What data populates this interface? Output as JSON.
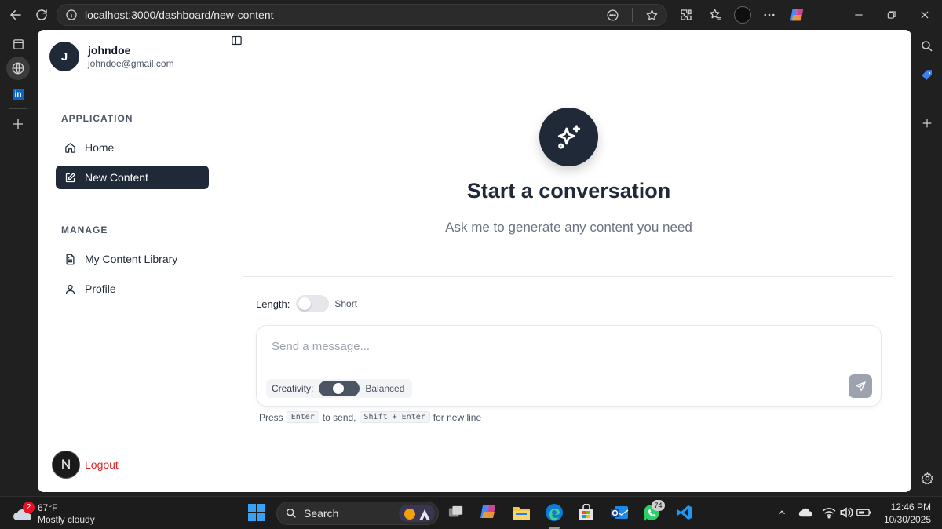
{
  "browser": {
    "url": "localhost:3000/dashboard/new-content"
  },
  "user": {
    "initial": "J",
    "name": "johndoe",
    "email": "johndoe@gmail.com"
  },
  "sidebar": {
    "sections": [
      {
        "label": "APPLICATION",
        "items": [
          {
            "label": "Home",
            "icon": "home-icon",
            "active": false
          },
          {
            "label": "New Content",
            "icon": "edit-icon",
            "active": true
          }
        ]
      },
      {
        "label": "MANAGE",
        "items": [
          {
            "label": "My Content Library",
            "icon": "document-icon",
            "active": false
          },
          {
            "label": "Profile",
            "icon": "user-icon",
            "active": false
          }
        ]
      }
    ],
    "logout": {
      "label": "Logout",
      "logo": "N"
    }
  },
  "hero": {
    "title": "Start a conversation",
    "subtitle": "Ask me to generate any content you need"
  },
  "composer": {
    "length_label": "Length:",
    "length_value": "Short",
    "placeholder": "Send a message...",
    "creativity_label": "Creativity:",
    "creativity_value": "Balanced"
  },
  "hint": {
    "press": "Press",
    "enter_key": "Enter",
    "to_send": "to send,",
    "shift_enter_key": "Shift + Enter",
    "for_new_line": "for new line"
  },
  "taskbar": {
    "weather_temp": "67°F",
    "weather_condition": "Mostly cloudy",
    "weather_badge": "2",
    "search_label": "Search",
    "whatsapp_badge": "74",
    "time": "12:46 PM",
    "date": "10/30/2025"
  },
  "colors": {
    "accent_dark": "#1f2937",
    "logout_red": "#dc2626",
    "send_disabled": "#9ca3af"
  }
}
